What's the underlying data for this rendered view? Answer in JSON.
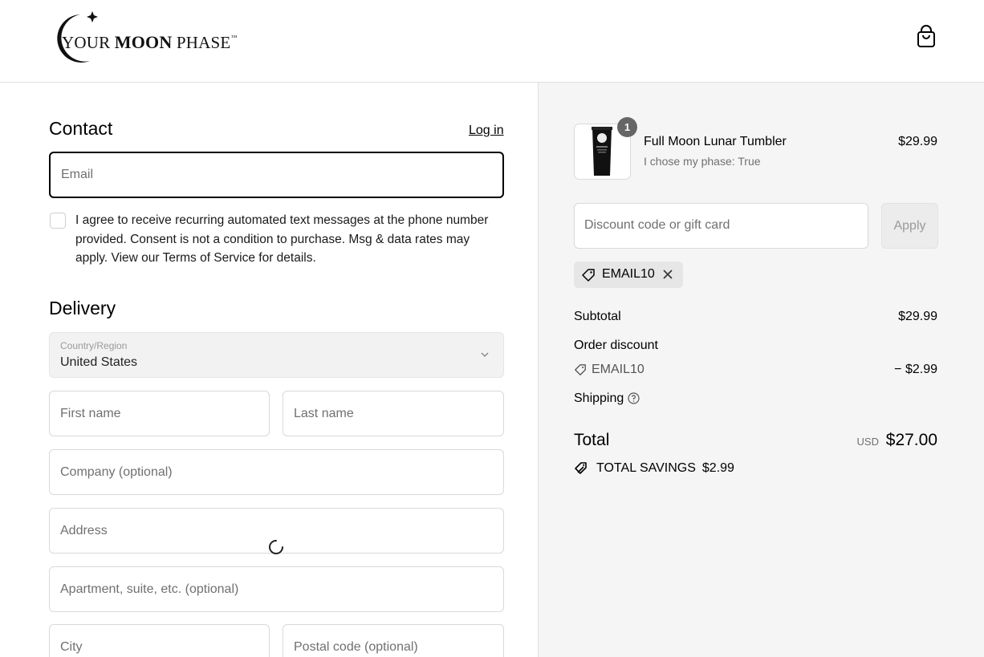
{
  "header": {
    "logo": {
      "word1": "YOUR",
      "word2": "MOON",
      "word3": "PHASE",
      "trademark": "™"
    },
    "bag_icon": "shopping-bag-icon"
  },
  "contact": {
    "heading": "Contact",
    "login_label": "Log in",
    "email_placeholder": "Email",
    "consent_text": "I agree to receive recurring automated text messages at the phone number provided. Consent is not a condition to purchase. Msg & data rates may apply. View our Terms of Service for details."
  },
  "delivery": {
    "heading": "Delivery",
    "country_label": "Country/Region",
    "country_value": "United States",
    "first_name_placeholder": "First name",
    "last_name_placeholder": "Last name",
    "company_placeholder": "Company (optional)",
    "address_placeholder": "Address",
    "apartment_placeholder": "Apartment, suite, etc. (optional)",
    "city_placeholder": "City",
    "postal_placeholder": "Postal code (optional)"
  },
  "summary": {
    "item": {
      "name": "Full Moon Lunar Tumbler",
      "variant": "I chose my phase: True",
      "price": "$29.99",
      "quantity": "1"
    },
    "discount_placeholder": "Discount code or gift card",
    "apply_label": "Apply",
    "applied_code": "EMAIL10",
    "subtotal_label": "Subtotal",
    "subtotal_value": "$29.99",
    "order_discount_label": "Order discount",
    "order_discount_code": "EMAIL10",
    "order_discount_value": "− $2.99",
    "shipping_label": "Shipping",
    "total_label": "Total",
    "total_currency": "USD",
    "total_value": "$27.00",
    "savings_label": "TOTAL SAVINGS",
    "savings_value": "$2.99"
  },
  "colors": {
    "accent": "#000000",
    "sidebar_bg": "#f5f5f5",
    "muted_text": "#707070",
    "border": "#d9d9d9"
  }
}
